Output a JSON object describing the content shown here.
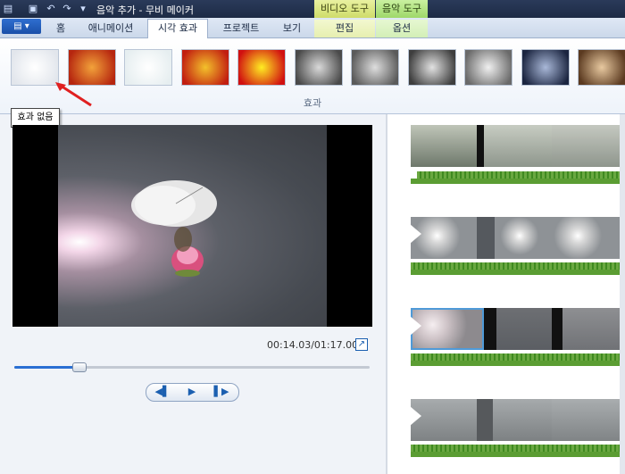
{
  "title": "음악 추가 - 무비 메이커",
  "context_tabs": {
    "video_tools": "비디오 도구",
    "music_tools": "음악 도구"
  },
  "tabs": [
    {
      "label": "홈"
    },
    {
      "label": "애니메이션"
    },
    {
      "label": "시각 효과"
    },
    {
      "label": "프로젝트"
    },
    {
      "label": "보기"
    },
    {
      "label": "편집"
    },
    {
      "label": "옵션"
    }
  ],
  "active_tab": "시각 효과",
  "ribbon": {
    "group_label": "효과",
    "tooltip": "효과 없음",
    "effects": [
      {
        "name": "no-effect",
        "colors": [
          "#ffffff",
          "#e2e6ec"
        ]
      },
      {
        "name": "effect-orange",
        "colors": [
          "#f2a23a",
          "#b6260f"
        ]
      },
      {
        "name": "effect-sketch",
        "colors": [
          "#ffffff",
          "#e6eef0"
        ]
      },
      {
        "name": "effect-red-flower",
        "colors": [
          "#f3c12b",
          "#c21e10"
        ]
      },
      {
        "name": "effect-threshold",
        "colors": [
          "#ffee22",
          "#d11010"
        ]
      },
      {
        "name": "effect-gray-1",
        "colors": [
          "#d9d9d9",
          "#4a4a4a"
        ]
      },
      {
        "name": "effect-gray-2",
        "colors": [
          "#dedede",
          "#5a5a5a"
        ]
      },
      {
        "name": "effect-gray-3",
        "colors": [
          "#e2e2e2",
          "#3e3e3e"
        ]
      },
      {
        "name": "effect-gray-4",
        "colors": [
          "#f0f0f0",
          "#6a6a6a"
        ]
      },
      {
        "name": "effect-blue",
        "colors": [
          "#a9b8d8",
          "#1b2540"
        ]
      },
      {
        "name": "effect-sepia",
        "colors": [
          "#e8c9a0",
          "#5b3a20"
        ]
      }
    ]
  },
  "player": {
    "timecode": "00:14.03/01:17.00",
    "progress": 0.18,
    "controls": {
      "prev": "◀▌",
      "play": "▶",
      "next": "▌▶"
    },
    "expand_icon": "↗"
  },
  "colors": {
    "accent": "#2a6fd3",
    "audio": "#5b9d33",
    "selection": "#4f9ad8"
  }
}
